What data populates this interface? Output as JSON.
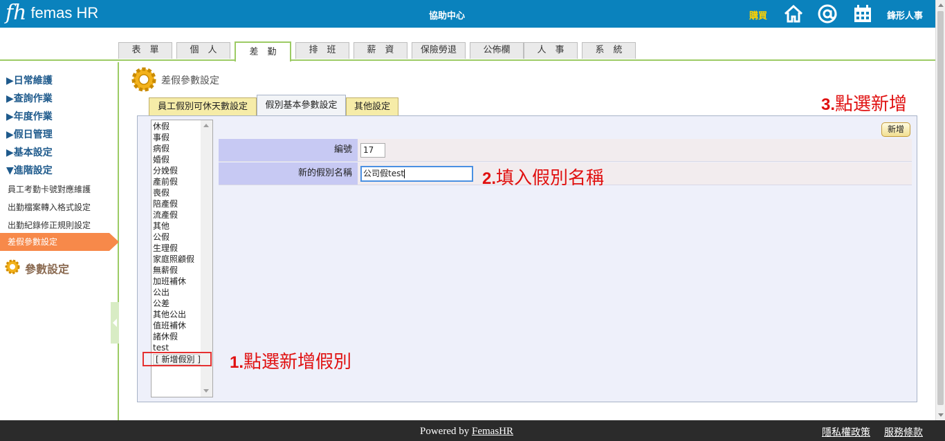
{
  "header": {
    "logo_mark": "fh",
    "logo_text": "femas HR",
    "help_center": "協助中心",
    "buy": "購買",
    "icons": [
      "home-icon",
      "at-icon",
      "calendar-icon"
    ],
    "company": "鋒形人事",
    "bg_color": "#0a82bd"
  },
  "top_tabs": [
    {
      "label": "表　單"
    },
    {
      "label": "個　人"
    },
    {
      "label": "差　勤",
      "active": true
    },
    {
      "label": "排　班"
    },
    {
      "label": "薪　資"
    },
    {
      "label": "保險勞退"
    },
    {
      "label": "公佈欄"
    },
    {
      "label": "人　事"
    },
    {
      "label": "系　統"
    }
  ],
  "sidebar": {
    "main_items": [
      "▶日常維護",
      "▶查詢作業",
      "▶年度作業",
      "▶假日管理",
      "▶基本設定",
      "▼進階設定"
    ],
    "sub_items": [
      "員工考勤卡號對應維護",
      "出勤檔案轉入格式設定",
      "出勤紀錄修正規則設定"
    ],
    "active_item": "差假參數設定",
    "section_title": "參數設定",
    "accent": "#f7894a"
  },
  "main": {
    "page_title": "差假參數設定",
    "subtabs": [
      {
        "label": "員工假別可休天數設定"
      },
      {
        "label": "假別基本參數設定",
        "active": true
      },
      {
        "label": "其他設定"
      }
    ],
    "leave_types": [
      "休假",
      "事假",
      "病假",
      "婚假",
      "分娩假",
      "產前假",
      "喪假",
      "陪產假",
      "流產假",
      "其他",
      "公假",
      "生理假",
      "家庭照顧假",
      "無薪假",
      "加班補休",
      "公出",
      "公差",
      "其他公出",
      "值班補休",
      "諸休假",
      "test"
    ],
    "add_leave_type": "[ 新增假別 ]",
    "add_button": "新增",
    "fields": {
      "number_label": "編號",
      "number_value": "17",
      "name_label": "新的假別名稱",
      "name_value": "公司假test"
    }
  },
  "annotations": {
    "step1": {
      "num": "1.",
      "text": "點選新增假別"
    },
    "step2": {
      "num": "2.",
      "text": "填入假別名稱"
    },
    "step3": {
      "num": "3.",
      "text": "點選新增"
    },
    "color": "#e01010"
  },
  "footer": {
    "powered_prefix": "Powered by ",
    "powered_link": "FemasHR",
    "privacy": "隱私權政策",
    "terms": "服務條款"
  }
}
